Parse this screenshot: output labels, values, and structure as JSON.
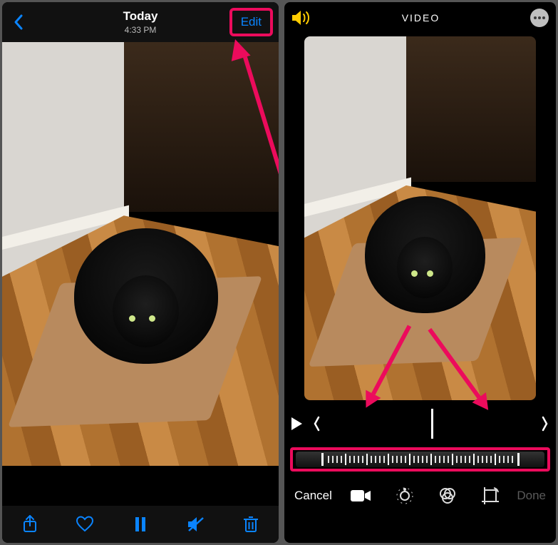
{
  "left": {
    "title": "Today",
    "subtitle": "4:33 PM",
    "edit_label": "Edit"
  },
  "right": {
    "title": "VIDEO",
    "cancel_label": "Cancel",
    "done_label": "Done"
  }
}
